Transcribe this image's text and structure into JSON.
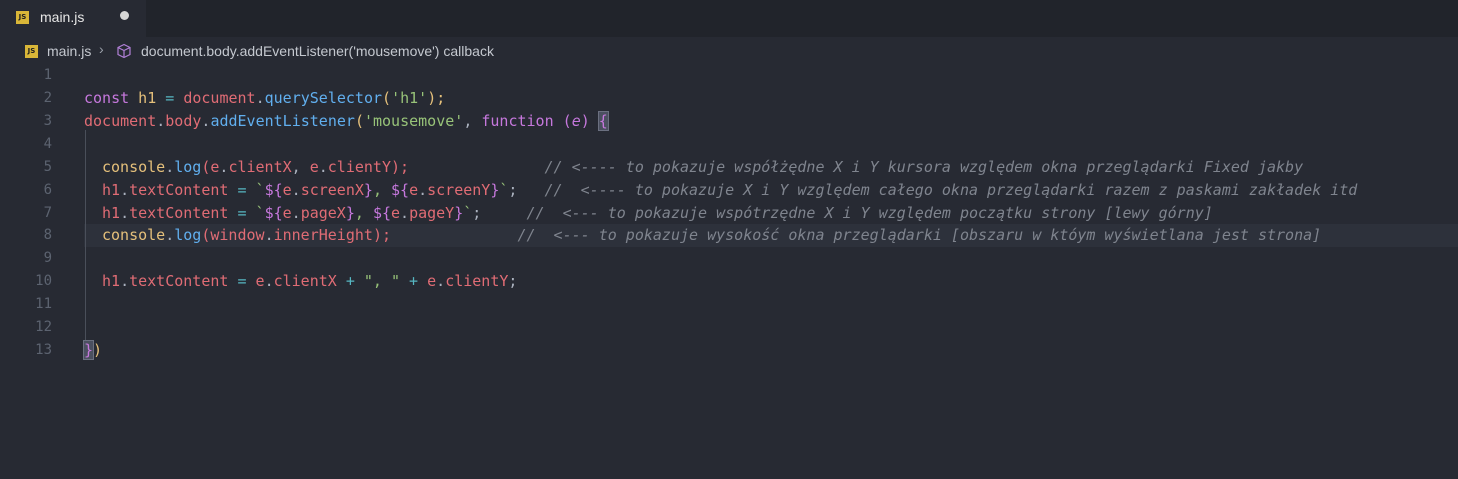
{
  "tab": {
    "label": "main.js",
    "icon": "js-file-icon",
    "badge": "JS",
    "modified": true
  },
  "breadcrumb": {
    "file": "main.js",
    "separator": "›",
    "symbol_icon": "cube-method-icon",
    "symbol": "document.body.addEventListener('mousemove') callback"
  },
  "editor": {
    "line_numbers": [
      "1",
      "2",
      "3",
      "4",
      "5",
      "6",
      "7",
      "8",
      "9",
      "10",
      "11",
      "12",
      "13"
    ],
    "lines": {
      "l2": {
        "kw": "const",
        "name": " h1 ",
        "eq": "=",
        "obj": " document",
        "dot": ".",
        "fn": "querySelector",
        "open": "(",
        "str": "'h1'",
        "close": ");"
      },
      "l3": {
        "obj": "document",
        "dot1": ".",
        "prop": "body",
        "dot2": ".",
        "fn": "addEventListener",
        "open": "(",
        "str": "'mousemove'",
        "comma": ", ",
        "kw": "function",
        "sp": " (",
        "param": "e",
        "close": ") ",
        "brace": "{"
      },
      "l5": {
        "obj": "console",
        "dot": ".",
        "fn": "log",
        "open": "(",
        "a1": "e",
        "d1": ".",
        "p1": "clientX",
        "comma": ", ",
        "a2": "e",
        "d2": ".",
        "p2": "clientY",
        "close": ");",
        "pad": "               ",
        "comment": "// <---- to pokazuje współżędne X i Y kursora względem okna przeglądarki Fixed jakby"
      },
      "l6": {
        "obj": "h1",
        "dot": ".",
        "prop": "textContent",
        "eq": " = ",
        "tick1": "`",
        "i1o": "${",
        "a1": "e",
        "d1": ".",
        "p1": "screenX",
        "i1c": "}",
        "mid": ", ",
        "i2o": "${",
        "a2": "e",
        "d2": ".",
        "p2": "screenY",
        "i2c": "}",
        "tick2": "`",
        "semi": ";",
        "pad": "   ",
        "comment": "//  <---- to pokazuje X i Y względem całego okna przeglądarki razem z paskami zakładek itd"
      },
      "l7": {
        "obj": "h1",
        "dot": ".",
        "prop": "textContent",
        "eq": " = ",
        "tick1": "`",
        "i1o": "${",
        "a1": "e",
        "d1": ".",
        "p1": "pageX",
        "i1c": "}",
        "mid": ", ",
        "i2o": "${",
        "a2": "e",
        "d2": ".",
        "p2": "pageY",
        "i2c": "}",
        "tick2": "`",
        "semi": ";",
        "pad": "     ",
        "comment": "//  <--- to pokazuje wspótrzędne X i Y względem początku strony [lewy górny]"
      },
      "l8": {
        "obj": "console",
        "dot": ".",
        "fn": "log",
        "open": "(",
        "a1": "window",
        "d1": ".",
        "p1": "innerHeight",
        "close": ");",
        "pad": "              ",
        "comment": "//  <--- to pokazuje wysokość okna przeglądarki [obszaru w któym wyświetlana jest strona]"
      },
      "l10": {
        "obj": "h1",
        "dot": ".",
        "prop": "textContent",
        "eq": " = ",
        "a1": "e",
        "d1": ".",
        "p1": "clientX",
        "plus1": " + ",
        "str": "\", \"",
        "plus2": " + ",
        "a2": "e",
        "d2": ".",
        "p2": "clientY",
        "semi": ";"
      },
      "l13": {
        "brace": "}",
        "paren": ")"
      }
    }
  },
  "colors": {
    "background": "#272a33",
    "tabbar": "#21242b",
    "keyword": "#c678dd",
    "variable": "#e06c75",
    "function": "#61afef",
    "string": "#98c379",
    "comment": "#7f848e"
  }
}
